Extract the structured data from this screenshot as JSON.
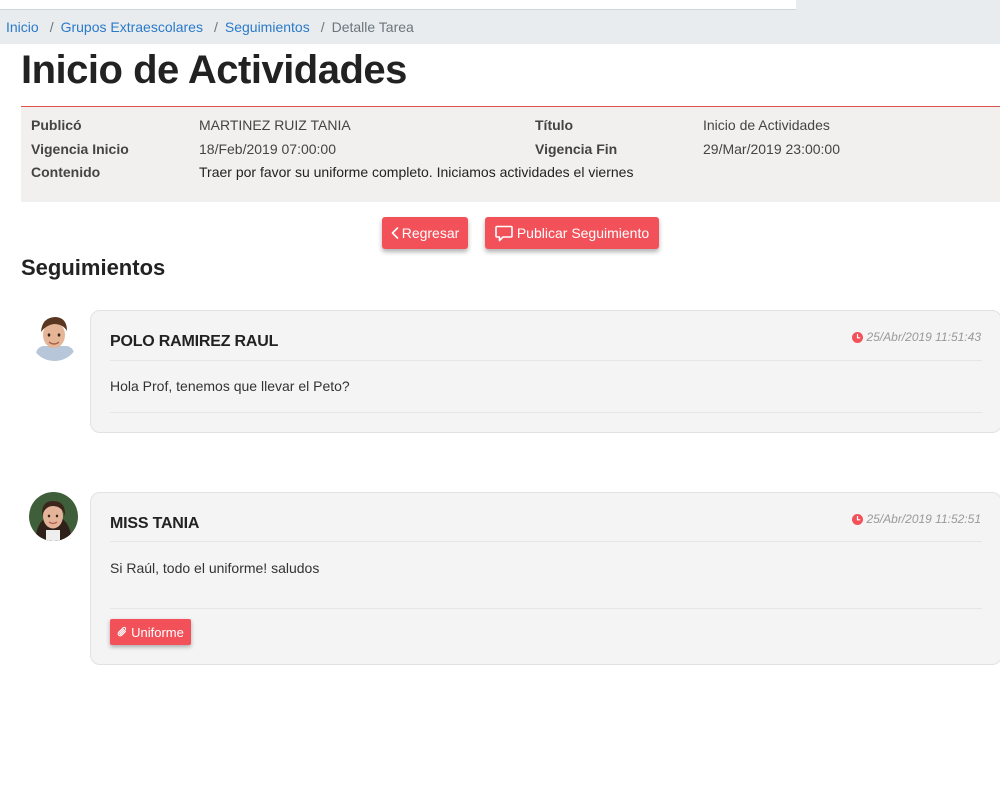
{
  "colors": {
    "accent": "#f2515a",
    "link": "#2a7ac9",
    "panel_border": "#e0524e",
    "panel_bg": "#f2f0ef",
    "card_bg": "#f4f4f4"
  },
  "breadcrumb": [
    {
      "label": "Inicio"
    },
    {
      "label": "Grupos Extraescolares"
    },
    {
      "label": "Seguimientos"
    },
    {
      "label": "Detalle Tarea"
    }
  ],
  "page": {
    "title": "Inicio de Actividades"
  },
  "details": {
    "published_by_label": "Publicó",
    "published_by": "MARTINEZ RUIZ TANIA",
    "title_label": "Título",
    "title": "Inicio de Actividades",
    "start_label": "Vigencia Inicio",
    "start": "18/Feb/2019 07:00:00",
    "end_label": "Vigencia Fin",
    "end": "29/Mar/2019 23:00:00",
    "content_label": "Contenido",
    "content": "Traer por favor su uniforme completo. Iniciamos actividades el viernes"
  },
  "actions": {
    "back_label": "Regresar",
    "back_icon": "chevron-left-icon",
    "publish_label": "Publicar Seguimiento",
    "publish_icon": "comment-icon"
  },
  "followups": {
    "section_title": "Seguimientos",
    "items": [
      {
        "author": "POLO RAMIREZ RAUL",
        "timestamp": "25/Abr/2019 11:51:43",
        "message": "Hola Prof, tenemos que llevar el Peto?"
      },
      {
        "author": "MISS TANIA",
        "timestamp": "25/Abr/2019 11:52:51",
        "message": "Si Raúl, todo el uniforme! saludos",
        "attachment_label": "Uniforme",
        "attachment_icon": "paperclip-icon"
      }
    ]
  }
}
